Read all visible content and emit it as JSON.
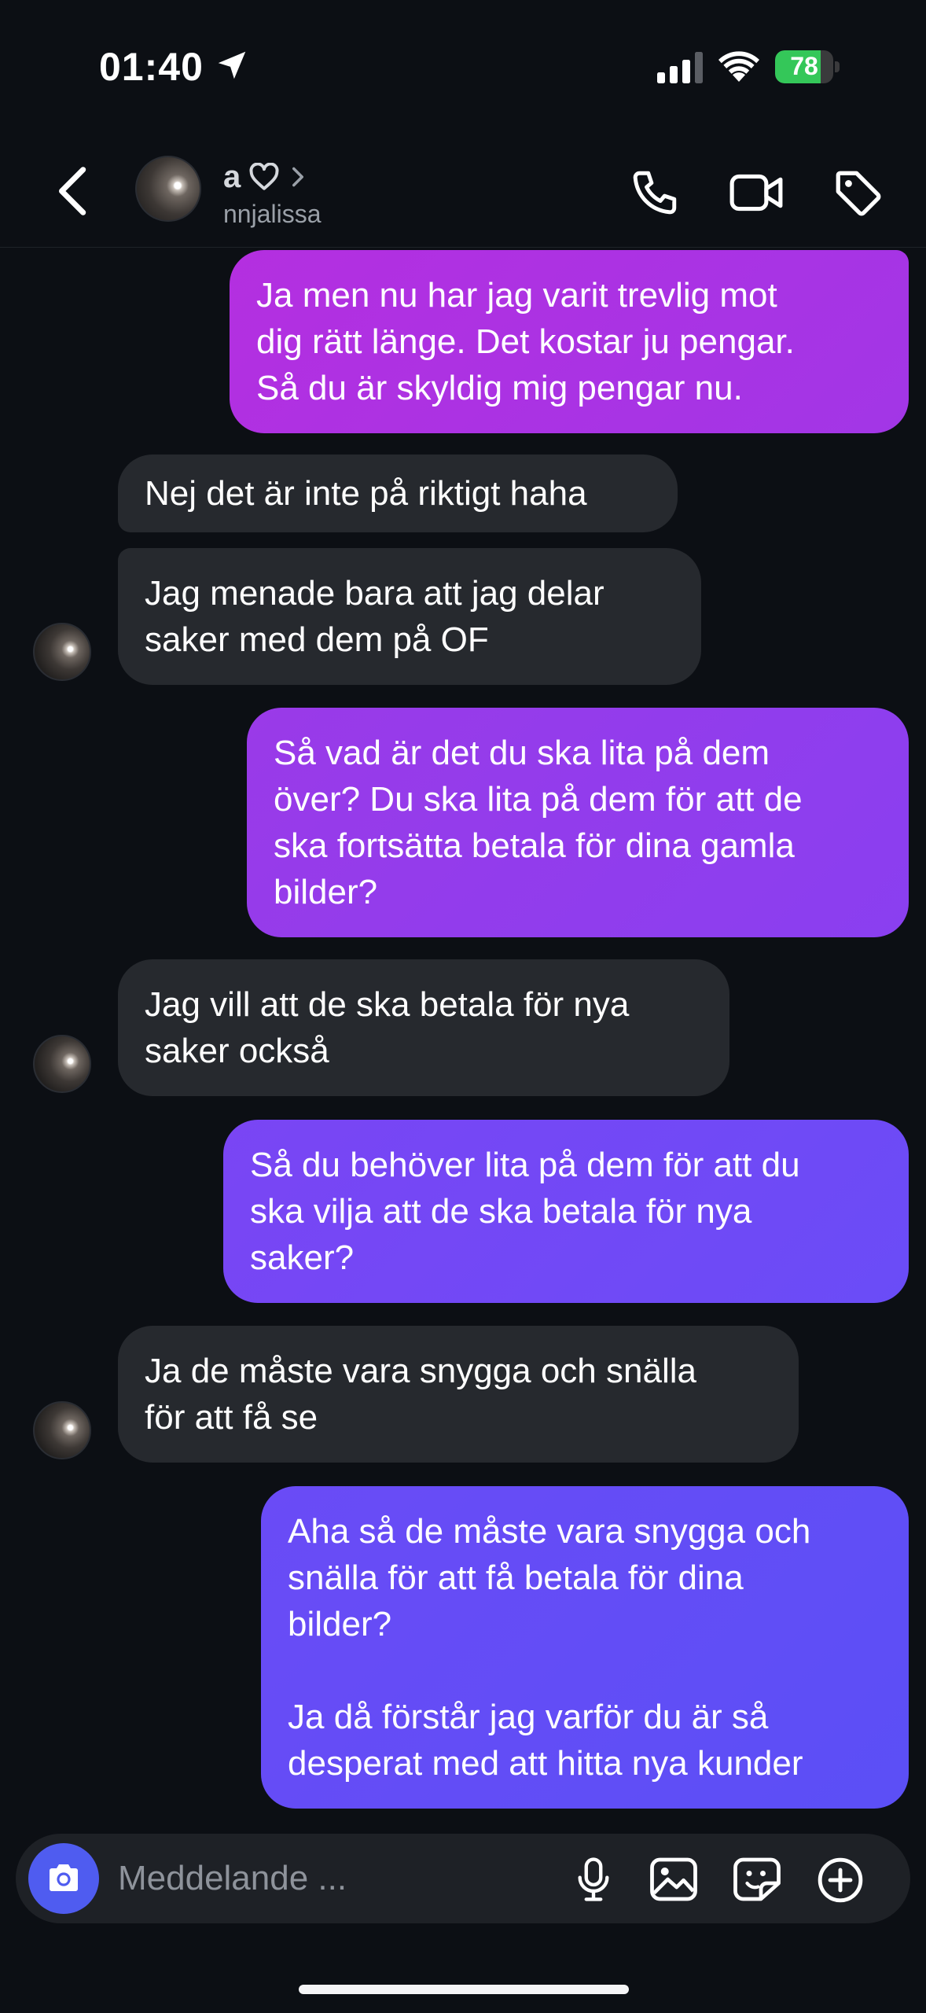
{
  "status_bar": {
    "time": "01:40",
    "battery_percent": 78,
    "battery_label": "78",
    "icons": [
      "location-arrow-icon",
      "cellular-signal-icon",
      "wifi-icon",
      "battery-charging-icon"
    ]
  },
  "header": {
    "back_icon": "chevron-left-icon",
    "contact_name": "a",
    "contact_username": "nnjalissa",
    "name_icons": [
      "heart-outline-icon",
      "chevron-right-icon"
    ],
    "actions": [
      "phone-icon",
      "video-camera-icon",
      "tag-icon"
    ]
  },
  "messages": [
    {
      "sender": "me",
      "text": "Ja men nu har jag varit trevlig mot\ndig rätt länge. Det kostar ju pengar.\nSå du är skyldig mig pengar nu."
    },
    {
      "sender": "them",
      "text": "Nej det är inte på riktigt haha"
    },
    {
      "sender": "them",
      "text": "Jag menade bara att jag delar\nsaker med dem på OF"
    },
    {
      "sender": "me",
      "text": "Så vad är det du ska lita på dem\növer? Du ska lita på dem för att de\nska fortsätta betala för dina gamla\nbilder?"
    },
    {
      "sender": "them",
      "text": "Jag vill att de ska betala för nya\nsaker också"
    },
    {
      "sender": "me",
      "text": "Så du behöver lita på dem för att du\nska vilja att de ska betala för nya\nsaker?"
    },
    {
      "sender": "them",
      "text": "Ja de måste vara snygga och snälla\nför att få se"
    },
    {
      "sender": "me",
      "text": "Aha så de måste vara snygga och\nsnälla för att få betala för dina\nbilder?\n\nJa då förstår jag varför du är så\ndesperat med att hitta nya kunder"
    }
  ],
  "composer": {
    "placeholder": "Meddelande ...",
    "value": "",
    "icons": [
      "camera-icon",
      "microphone-icon",
      "gallery-icon",
      "sticker-icon",
      "plus-circle-icon"
    ]
  },
  "colors": {
    "background": "#0c0f14",
    "incoming_bubble": "#26292e",
    "outgoing_gradient_top": "#b42fe0",
    "outgoing_gradient_bottom": "#5b4ff6",
    "camera_button": "#4f5cf0"
  }
}
